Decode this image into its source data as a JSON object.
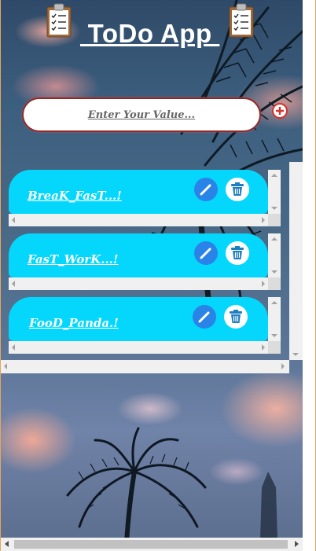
{
  "header": {
    "title": " ToDo App ",
    "left_icon": "clipboard-checklist-icon",
    "right_icon": "clipboard-checklist-icon"
  },
  "input": {
    "placeholder": "Enter Your Value...",
    "value": ""
  },
  "add_button": {
    "icon": "add-circle-icon"
  },
  "todos": [
    {
      "text": "BreaK_FasT...!",
      "edit_icon": "pencil-icon",
      "delete_icon": "trash-icon"
    },
    {
      "text": "FasT_WorK...!",
      "edit_icon": "pencil-icon",
      "delete_icon": "trash-icon"
    },
    {
      "text": "FooD_Panda.!",
      "edit_icon": "pencil-icon",
      "delete_icon": "trash-icon"
    }
  ],
  "colors": {
    "todo_pill": "#04d7fb",
    "edit_button": "#2a84e8",
    "add_button_ring": "#d4342c",
    "input_border": "#8f2a2a",
    "title": "#ffffff"
  }
}
